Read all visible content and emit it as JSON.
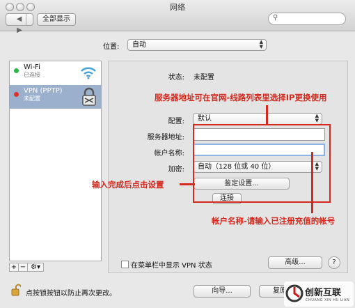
{
  "window": {
    "title": "网络",
    "show_all_label": "全部显示",
    "nav_back": "◀",
    "nav_fwd": "▶",
    "search_placeholder": ""
  },
  "location": {
    "label": "位置:",
    "value": "自动"
  },
  "services": [
    {
      "name": "Wi-Fi",
      "status": "已连接",
      "status_color": "#2fb84a",
      "icon": "wifi-icon"
    },
    {
      "name": "VPN (PPTP)",
      "status": "未配置",
      "status_color": "#d9342b",
      "icon": "lock-icon"
    }
  ],
  "sidebar_buttons": {
    "add": "+",
    "remove": "−",
    "action": "⚙▾"
  },
  "detail": {
    "status_label": "状态:",
    "status_value": "未配置",
    "config_label": "配置:",
    "config_value": "默认",
    "server_label": "服务器地址:",
    "server_value": "",
    "account_label": "帐户名称:",
    "account_value": "",
    "encryption_label": "加密:",
    "encryption_value": "自动（128 位或 40 位）",
    "auth_button": "鉴定设置...",
    "connect_button": "连接",
    "show_vpn_checkbox": "在菜单栏中显示 VPN 状态",
    "advanced_button": "高级...",
    "help_button": "?"
  },
  "annotations": {
    "top": "服务器地址可在官网-线路列表里选择IP更换使用",
    "left": "输入完成后点击设置",
    "bottom": "帐户名称-请输入已注册充值的帐号",
    "color": "#d22a1f"
  },
  "footer": {
    "lock_text": "点按锁按钮以防止再次更改。",
    "assistant_button": "向导...",
    "revert_button": "复原"
  },
  "watermark": {
    "text": "创新互联",
    "sub": "CHUANG XIN HU LIAN"
  }
}
